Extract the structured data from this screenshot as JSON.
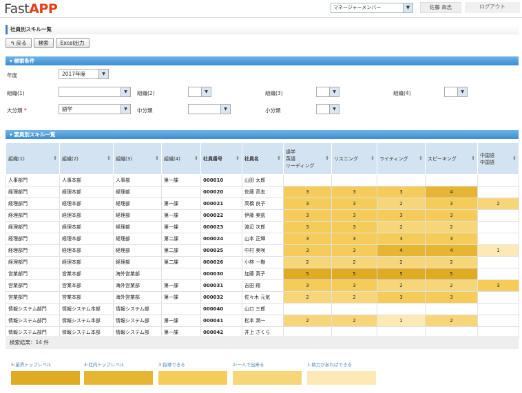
{
  "header": {
    "logo_a": "Fast",
    "logo_b": "APP",
    "role": "マネージャーメンバー",
    "user": "佐藤 高志",
    "logout": "ログアウト"
  },
  "page_title": "社員別スキル一覧",
  "toolbar": {
    "back": "戻る",
    "search": "検索",
    "excel": "Excel出力"
  },
  "search": {
    "section_title": "検索条件",
    "year_label": "年度",
    "year_value": "2017年度",
    "org1_label": "組織(1)",
    "org2_label": "組織(2)",
    "org3_label": "組織(3)",
    "org4_label": "組織(4)",
    "major_label": "大分類",
    "major_value": "語学",
    "medium_label": "中分類",
    "minor_label": "小分類",
    "required_mark": "*"
  },
  "list": {
    "section_title": "要員別スキル一覧",
    "headers": [
      "組織(1)",
      "組織(2)",
      "組織(3)",
      "組織(4)",
      "社員番号",
      "社員名",
      "語学\n英語\nリーディング",
      "リスニング",
      "ライティング",
      "スピーキング",
      "中国語\n中国語"
    ],
    "rows": [
      [
        "人事部門",
        "人事本部",
        "人事部",
        "第一課",
        "000010",
        "山田 太郎",
        "",
        "",
        "",
        "",
        ""
      ],
      [
        "経理部門",
        "経理本部",
        "経理部",
        "",
        "000020",
        "佐藤 高志",
        "3",
        "3",
        "3",
        "4",
        ""
      ],
      [
        "経理部門",
        "経理本部",
        "経理部",
        "第一課",
        "000021",
        "高橋 良子",
        "3",
        "3",
        "2",
        "3",
        "2"
      ],
      [
        "経理部門",
        "経理本部",
        "経理部",
        "第一課",
        "000022",
        "伊藤 美凱",
        "3",
        "3",
        "3",
        "3",
        ""
      ],
      [
        "経理部門",
        "経理本部",
        "経理部",
        "第一課",
        "000023",
        "渡辺 次郎",
        "3",
        "3",
        "2",
        "2",
        ""
      ],
      [
        "経理部門",
        "経理本部",
        "経理部",
        "第二課",
        "000024",
        "山本 正輝",
        "3",
        "3",
        "3",
        "3",
        ""
      ],
      [
        "経理部門",
        "経理本部",
        "経理部",
        "第二課",
        "000025",
        "中村 美咲",
        "3",
        "3",
        "4",
        "4",
        "1"
      ],
      [
        "経理部門",
        "経理本部",
        "経理部",
        "第二課",
        "000026",
        "小林 一樹",
        "2",
        "2",
        "2",
        "2",
        ""
      ],
      [
        "営業部門",
        "営業本部",
        "海外営業部",
        "",
        "000030",
        "加藤 真子",
        "5",
        "5",
        "5",
        "5",
        ""
      ],
      [
        "営業部門",
        "営業本部",
        "海外営業部",
        "第一課",
        "000031",
        "吉田 翔",
        "3",
        "3",
        "2",
        "2",
        "3"
      ],
      [
        "営業部門",
        "営業本部",
        "海外営業部",
        "第一課",
        "000032",
        "佐々木 元気",
        "2",
        "2",
        "3",
        "3",
        ""
      ],
      [
        "情報システム部門",
        "情報システム本部",
        "情報システム部",
        "",
        "000040",
        "山口 三郎",
        "",
        "",
        "",
        "",
        ""
      ],
      [
        "情報システム部門",
        "情報システム本部",
        "情報システム部",
        "第一課",
        "000041",
        "松本 潤一",
        "2",
        "2",
        "1",
        "2",
        ""
      ],
      [
        "情報システム部門",
        "情報システム本部",
        "情報システム部",
        "第一課",
        "000042",
        "井上 さくら",
        "",
        "",
        "",
        "",
        ""
      ]
    ]
  },
  "result": "検索結果：14 件",
  "legend": [
    {
      "label": "5:業界トップレベル",
      "color": "#dfaa24"
    },
    {
      "label": "4:社内トップレベル",
      "color": "#e6b532"
    },
    {
      "label": "3:指導できる",
      "color": "#f5cc5a"
    },
    {
      "label": "2:一人で出来る",
      "color": "#f7d67a"
    },
    {
      "label": "1:助力があればできる",
      "color": "#fbeab5"
    }
  ]
}
